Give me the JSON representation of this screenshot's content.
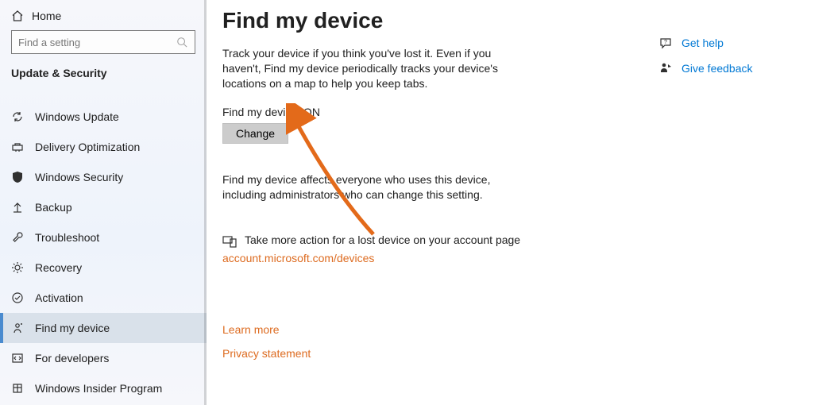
{
  "sidebar": {
    "home_label": "Home",
    "search_placeholder": "Find a setting",
    "section_title": "Update & Security",
    "items": [
      {
        "label": "Windows Update"
      },
      {
        "label": "Delivery Optimization"
      },
      {
        "label": "Windows Security"
      },
      {
        "label": "Backup"
      },
      {
        "label": "Troubleshoot"
      },
      {
        "label": "Recovery"
      },
      {
        "label": "Activation"
      },
      {
        "label": "Find my device"
      },
      {
        "label": "For developers"
      },
      {
        "label": "Windows Insider Program"
      }
    ]
  },
  "main": {
    "title": "Find my device",
    "description": "Track your device if you think you've lost it. Even if you haven't, Find my device periodically tracks your device's locations on a map to help you keep tabs.",
    "status_label": "Find my device: ON",
    "change_button": "Change",
    "affects_text": "Find my device affects everyone who uses this device, including administrators who can change this setting.",
    "action_text": "Take more action for a lost device on your account page",
    "action_link": "account.microsoft.com/devices",
    "learn_more": "Learn more",
    "privacy": "Privacy statement"
  },
  "help": {
    "get_help": "Get help",
    "give_feedback": "Give feedback"
  },
  "colors": {
    "accent": "#0078d4",
    "annotation": "#dd6b20"
  }
}
